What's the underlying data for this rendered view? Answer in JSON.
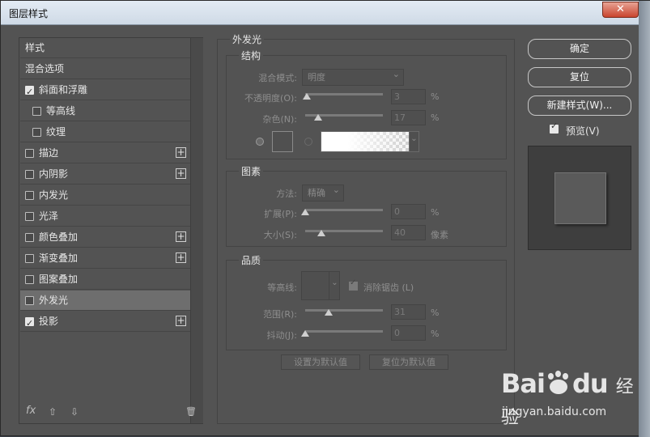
{
  "window": {
    "title": "图层样式",
    "close": "✕"
  },
  "styles_list": {
    "items": [
      {
        "label": "样式",
        "checkbox": false,
        "checked": false,
        "plus": false,
        "indent": 0
      },
      {
        "label": "混合选项",
        "checkbox": false,
        "checked": false,
        "plus": false,
        "indent": 0
      },
      {
        "label": "斜面和浮雕",
        "checkbox": true,
        "checked": true,
        "plus": false,
        "indent": 0
      },
      {
        "label": "等高线",
        "checkbox": true,
        "checked": false,
        "plus": false,
        "indent": 1
      },
      {
        "label": "纹理",
        "checkbox": true,
        "checked": false,
        "plus": false,
        "indent": 1
      },
      {
        "label": "描边",
        "checkbox": true,
        "checked": false,
        "plus": true,
        "indent": 0
      },
      {
        "label": "内阴影",
        "checkbox": true,
        "checked": false,
        "plus": true,
        "indent": 0
      },
      {
        "label": "内发光",
        "checkbox": true,
        "checked": false,
        "plus": false,
        "indent": 0
      },
      {
        "label": "光泽",
        "checkbox": true,
        "checked": false,
        "plus": false,
        "indent": 0
      },
      {
        "label": "颜色叠加",
        "checkbox": true,
        "checked": false,
        "plus": true,
        "indent": 0
      },
      {
        "label": "渐变叠加",
        "checkbox": true,
        "checked": false,
        "plus": true,
        "indent": 0
      },
      {
        "label": "图案叠加",
        "checkbox": true,
        "checked": false,
        "plus": false,
        "indent": 0
      },
      {
        "label": "外发光",
        "checkbox": true,
        "checked": false,
        "plus": false,
        "indent": 0,
        "selected": true
      },
      {
        "label": "投影",
        "checkbox": true,
        "checked": true,
        "plus": true,
        "indent": 0
      }
    ],
    "footer": {
      "fx": "fx",
      "up": "⇧",
      "down": "⇩",
      "trash": "🗑"
    }
  },
  "outer_glow": {
    "title": "外发光",
    "structure": {
      "title": "结构",
      "blend_mode_label": "混合模式:",
      "blend_mode_value": "明度",
      "opacity_label": "不透明度(O):",
      "opacity_value": "3",
      "noise_label": "杂色(N):",
      "noise_value": "17",
      "unit": "%"
    },
    "elements": {
      "title": "图素",
      "method_label": "方法:",
      "method_value": "精确",
      "spread_label": "扩展(P):",
      "spread_value": "0",
      "size_label": "大小(S):",
      "size_value": "40",
      "size_unit": "像素",
      "unit": "%"
    },
    "quality": {
      "title": "品质",
      "contour_label": "等高线:",
      "antialias_label": "消除锯齿 (L)",
      "range_label": "范围(R):",
      "range_value": "31",
      "jitter_label": "抖动(J):",
      "jitter_value": "0",
      "unit": "%"
    },
    "buttons": {
      "set_default": "设置为默认值",
      "reset_default": "复位为默认值"
    }
  },
  "actions": {
    "ok": "确定",
    "reset": "复位",
    "new_style": "新建样式(W)...",
    "preview_label": "预览(V)"
  },
  "watermark": {
    "brand": "Bai",
    "brand2": "du",
    "brand3": "经验",
    "url": "jingyan.baidu.com"
  }
}
